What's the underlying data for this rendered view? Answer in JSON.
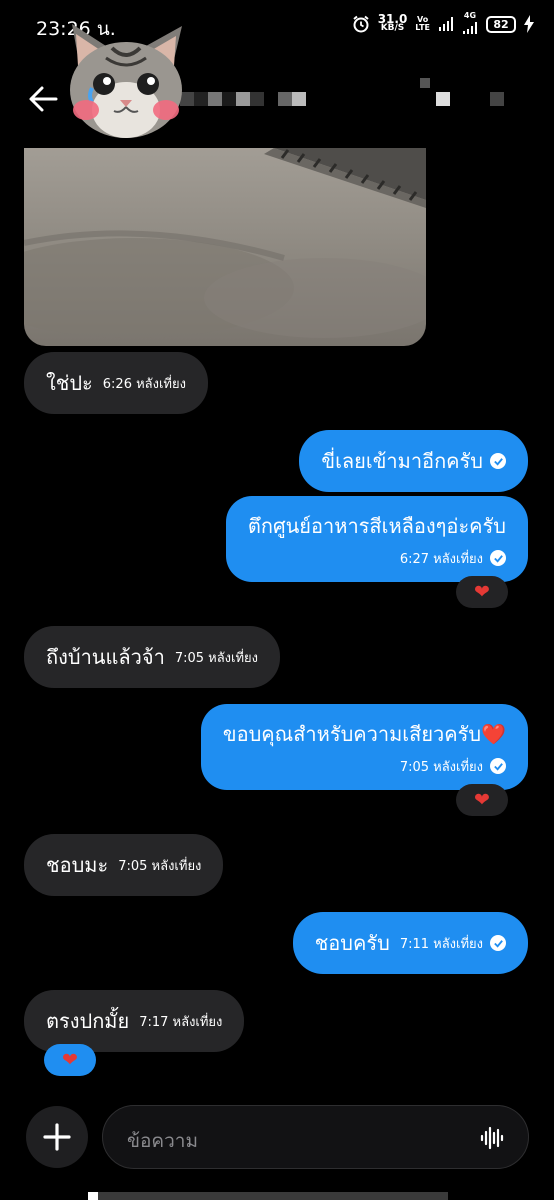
{
  "status_bar": {
    "time": "23:26 น.",
    "net_speed": "31.0",
    "net_unit": "KB/S",
    "volte_top": "Vo",
    "volte_bottom": "LTE",
    "signal": "4G",
    "battery": "82"
  },
  "messages": [
    {
      "dir": "in",
      "text": "ใช่ปะ",
      "time": "6:26 หลังเที่ยง"
    },
    {
      "dir": "out",
      "text": "ขี่เลยเข้ามาอีกครับ",
      "time": ""
    },
    {
      "dir": "out",
      "text": "ตึกศูนย์อาหารสีเหลืองๆอ่ะครับ",
      "time": "6:27 หลังเที่ยง"
    },
    {
      "dir": "in",
      "text": "ถึงบ้านแล้วจ้า",
      "time": "7:05 หลังเที่ยง"
    },
    {
      "dir": "out",
      "text": "ขอบคุณสำหรับความเสียวครับ❤️",
      "time": "7:05 หลังเที่ยง"
    },
    {
      "dir": "in",
      "text": "ชอบมะ",
      "time": "7:05 หลังเที่ยง"
    },
    {
      "dir": "out",
      "text": "ชอบครับ",
      "time": "7:11 หลังเที่ยง"
    },
    {
      "dir": "in",
      "text": "ตรงปกมั้ย",
      "time": "7:17 หลังเที่ยง"
    }
  ],
  "reactions": [
    "❤",
    "❤",
    "❤"
  ],
  "composer": {
    "placeholder": "ข้อความ",
    "add_icon": "plus-icon",
    "voice_icon": "waveform-icon"
  },
  "colors": {
    "outgoing": "#1f8ef1",
    "incoming": "#262628",
    "heart": "#e53935"
  }
}
